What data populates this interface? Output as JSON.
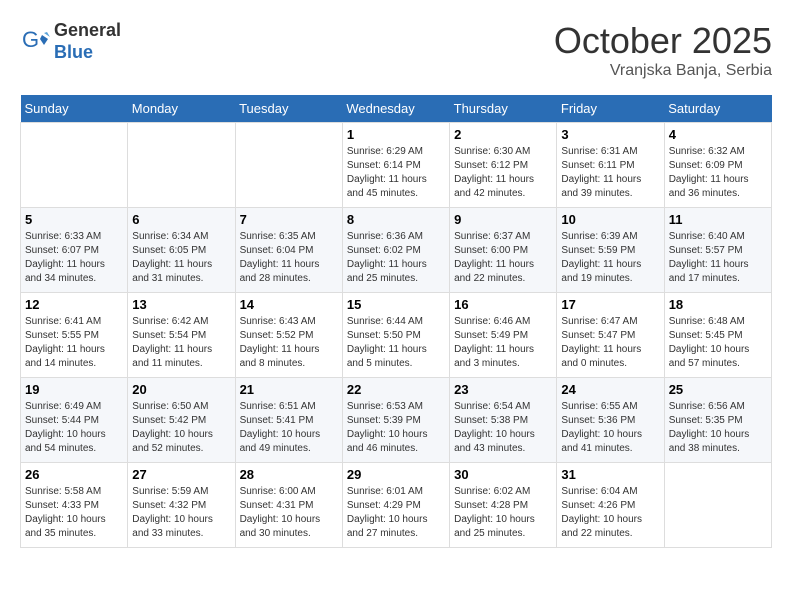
{
  "header": {
    "logo_general": "General",
    "logo_blue": "Blue",
    "month": "October 2025",
    "location": "Vranjska Banja, Serbia"
  },
  "days_of_week": [
    "Sunday",
    "Monday",
    "Tuesday",
    "Wednesday",
    "Thursday",
    "Friday",
    "Saturday"
  ],
  "weeks": [
    [
      {
        "day": "",
        "info": ""
      },
      {
        "day": "",
        "info": ""
      },
      {
        "day": "",
        "info": ""
      },
      {
        "day": "1",
        "info": "Sunrise: 6:29 AM\nSunset: 6:14 PM\nDaylight: 11 hours\nand 45 minutes."
      },
      {
        "day": "2",
        "info": "Sunrise: 6:30 AM\nSunset: 6:12 PM\nDaylight: 11 hours\nand 42 minutes."
      },
      {
        "day": "3",
        "info": "Sunrise: 6:31 AM\nSunset: 6:11 PM\nDaylight: 11 hours\nand 39 minutes."
      },
      {
        "day": "4",
        "info": "Sunrise: 6:32 AM\nSunset: 6:09 PM\nDaylight: 11 hours\nand 36 minutes."
      }
    ],
    [
      {
        "day": "5",
        "info": "Sunrise: 6:33 AM\nSunset: 6:07 PM\nDaylight: 11 hours\nand 34 minutes."
      },
      {
        "day": "6",
        "info": "Sunrise: 6:34 AM\nSunset: 6:05 PM\nDaylight: 11 hours\nand 31 minutes."
      },
      {
        "day": "7",
        "info": "Sunrise: 6:35 AM\nSunset: 6:04 PM\nDaylight: 11 hours\nand 28 minutes."
      },
      {
        "day": "8",
        "info": "Sunrise: 6:36 AM\nSunset: 6:02 PM\nDaylight: 11 hours\nand 25 minutes."
      },
      {
        "day": "9",
        "info": "Sunrise: 6:37 AM\nSunset: 6:00 PM\nDaylight: 11 hours\nand 22 minutes."
      },
      {
        "day": "10",
        "info": "Sunrise: 6:39 AM\nSunset: 5:59 PM\nDaylight: 11 hours\nand 19 minutes."
      },
      {
        "day": "11",
        "info": "Sunrise: 6:40 AM\nSunset: 5:57 PM\nDaylight: 11 hours\nand 17 minutes."
      }
    ],
    [
      {
        "day": "12",
        "info": "Sunrise: 6:41 AM\nSunset: 5:55 PM\nDaylight: 11 hours\nand 14 minutes."
      },
      {
        "day": "13",
        "info": "Sunrise: 6:42 AM\nSunset: 5:54 PM\nDaylight: 11 hours\nand 11 minutes."
      },
      {
        "day": "14",
        "info": "Sunrise: 6:43 AM\nSunset: 5:52 PM\nDaylight: 11 hours\nand 8 minutes."
      },
      {
        "day": "15",
        "info": "Sunrise: 6:44 AM\nSunset: 5:50 PM\nDaylight: 11 hours\nand 5 minutes."
      },
      {
        "day": "16",
        "info": "Sunrise: 6:46 AM\nSunset: 5:49 PM\nDaylight: 11 hours\nand 3 minutes."
      },
      {
        "day": "17",
        "info": "Sunrise: 6:47 AM\nSunset: 5:47 PM\nDaylight: 11 hours\nand 0 minutes."
      },
      {
        "day": "18",
        "info": "Sunrise: 6:48 AM\nSunset: 5:45 PM\nDaylight: 10 hours\nand 57 minutes."
      }
    ],
    [
      {
        "day": "19",
        "info": "Sunrise: 6:49 AM\nSunset: 5:44 PM\nDaylight: 10 hours\nand 54 minutes."
      },
      {
        "day": "20",
        "info": "Sunrise: 6:50 AM\nSunset: 5:42 PM\nDaylight: 10 hours\nand 52 minutes."
      },
      {
        "day": "21",
        "info": "Sunrise: 6:51 AM\nSunset: 5:41 PM\nDaylight: 10 hours\nand 49 minutes."
      },
      {
        "day": "22",
        "info": "Sunrise: 6:53 AM\nSunset: 5:39 PM\nDaylight: 10 hours\nand 46 minutes."
      },
      {
        "day": "23",
        "info": "Sunrise: 6:54 AM\nSunset: 5:38 PM\nDaylight: 10 hours\nand 43 minutes."
      },
      {
        "day": "24",
        "info": "Sunrise: 6:55 AM\nSunset: 5:36 PM\nDaylight: 10 hours\nand 41 minutes."
      },
      {
        "day": "25",
        "info": "Sunrise: 6:56 AM\nSunset: 5:35 PM\nDaylight: 10 hours\nand 38 minutes."
      }
    ],
    [
      {
        "day": "26",
        "info": "Sunrise: 5:58 AM\nSunset: 4:33 PM\nDaylight: 10 hours\nand 35 minutes."
      },
      {
        "day": "27",
        "info": "Sunrise: 5:59 AM\nSunset: 4:32 PM\nDaylight: 10 hours\nand 33 minutes."
      },
      {
        "day": "28",
        "info": "Sunrise: 6:00 AM\nSunset: 4:31 PM\nDaylight: 10 hours\nand 30 minutes."
      },
      {
        "day": "29",
        "info": "Sunrise: 6:01 AM\nSunset: 4:29 PM\nDaylight: 10 hours\nand 27 minutes."
      },
      {
        "day": "30",
        "info": "Sunrise: 6:02 AM\nSunset: 4:28 PM\nDaylight: 10 hours\nand 25 minutes."
      },
      {
        "day": "31",
        "info": "Sunrise: 6:04 AM\nSunset: 4:26 PM\nDaylight: 10 hours\nand 22 minutes."
      },
      {
        "day": "",
        "info": ""
      }
    ]
  ]
}
